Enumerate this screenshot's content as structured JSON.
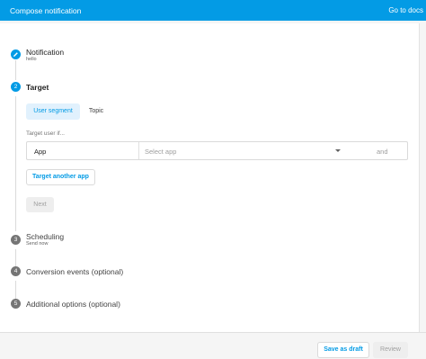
{
  "header": {
    "title": "Compose notification",
    "docs_link": "Go to docs"
  },
  "steps": [
    {
      "number": "",
      "icon": "pencil-icon",
      "title": "Notification",
      "subtitle": "hello",
      "state": "done"
    },
    {
      "number": "2",
      "title": "Target",
      "subtitle": "",
      "state": "active"
    },
    {
      "number": "3",
      "title": "Scheduling",
      "subtitle": "Send now",
      "state": "pending"
    },
    {
      "number": "4",
      "title": "Conversion events (optional)",
      "subtitle": "",
      "state": "pending"
    },
    {
      "number": "5",
      "title": "Additional options (optional)",
      "subtitle": "",
      "state": "pending"
    }
  ],
  "target": {
    "tabs": [
      "User segment",
      "Topic"
    ],
    "selected_tab": "User segment",
    "label": "Target user if...",
    "row": {
      "field": "App",
      "select_placeholder": "Select app",
      "and_label": "and"
    },
    "another_app_button": "Target another app",
    "next_button": "Next"
  },
  "footer": {
    "save_draft": "Save as draft",
    "review": "Review"
  },
  "colors": {
    "accent": "#039be5",
    "step_pending": "#757575"
  }
}
